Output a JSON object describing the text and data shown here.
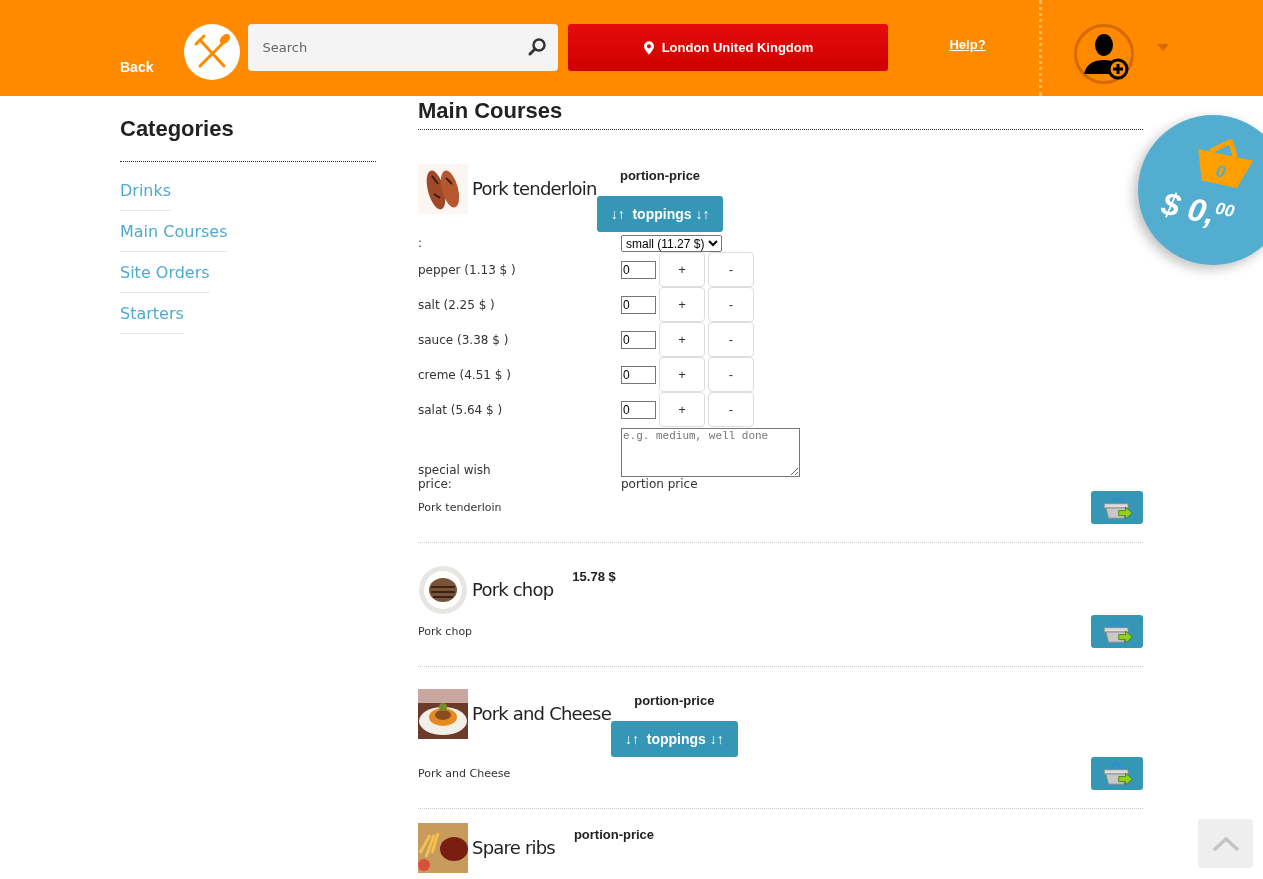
{
  "header": {
    "back": "Back",
    "search": {
      "placeholder": "Search"
    },
    "location": "London United Kingdom",
    "help": "Help?"
  },
  "cart": {
    "count": "0",
    "total": "$ 0,$^{00}$"
  },
  "sidebar": {
    "title": "Categories",
    "items": [
      {
        "label": "Drinks"
      },
      {
        "label": "Main Courses"
      },
      {
        "label": "Site Orders"
      },
      {
        "label": "Starters"
      }
    ]
  },
  "section": {
    "title": "Main Courses"
  },
  "dishes": [
    {
      "name": "Pork tenderloin",
      "price": "portion-price",
      "toppings_button": "↓↑  toppings ↓↑",
      "expanded": true,
      "size_label": ":",
      "size": "small (11.27 $)",
      "toppings": [
        {
          "label": "pepper (1.13 $ )",
          "value": "0",
          "plus": "+",
          "minus": "-"
        },
        {
          "label": "salt (2.25 $ )",
          "value": "0",
          "plus": "+",
          "minus": "-"
        },
        {
          "label": "sauce (3.38 $ )",
          "value": "0",
          "plus": "+",
          "minus": "-"
        },
        {
          "label": "creme (4.51 $ )",
          "value": "0",
          "plus": "+",
          "minus": "-"
        },
        {
          "label": "salat (5.64 $ )",
          "value": "0",
          "plus": "+",
          "minus": "-"
        }
      ],
      "wish_label": "special wish",
      "wish_placeholder": "e.g. medium, well done",
      "price_label": "price:",
      "price_value": "portion price",
      "description": "Pork tenderloin"
    },
    {
      "name": "Pork chop",
      "price": "15.78 $",
      "expanded": false,
      "description": "Pork chop"
    },
    {
      "name": "Pork and Cheese",
      "price": "portion-price",
      "toppings_button": "↓↑  toppings ↓↑",
      "expanded": false,
      "description": "Pork and Cheese"
    },
    {
      "name": "Spare ribs",
      "price": "portion-price",
      "expanded": false
    }
  ]
}
